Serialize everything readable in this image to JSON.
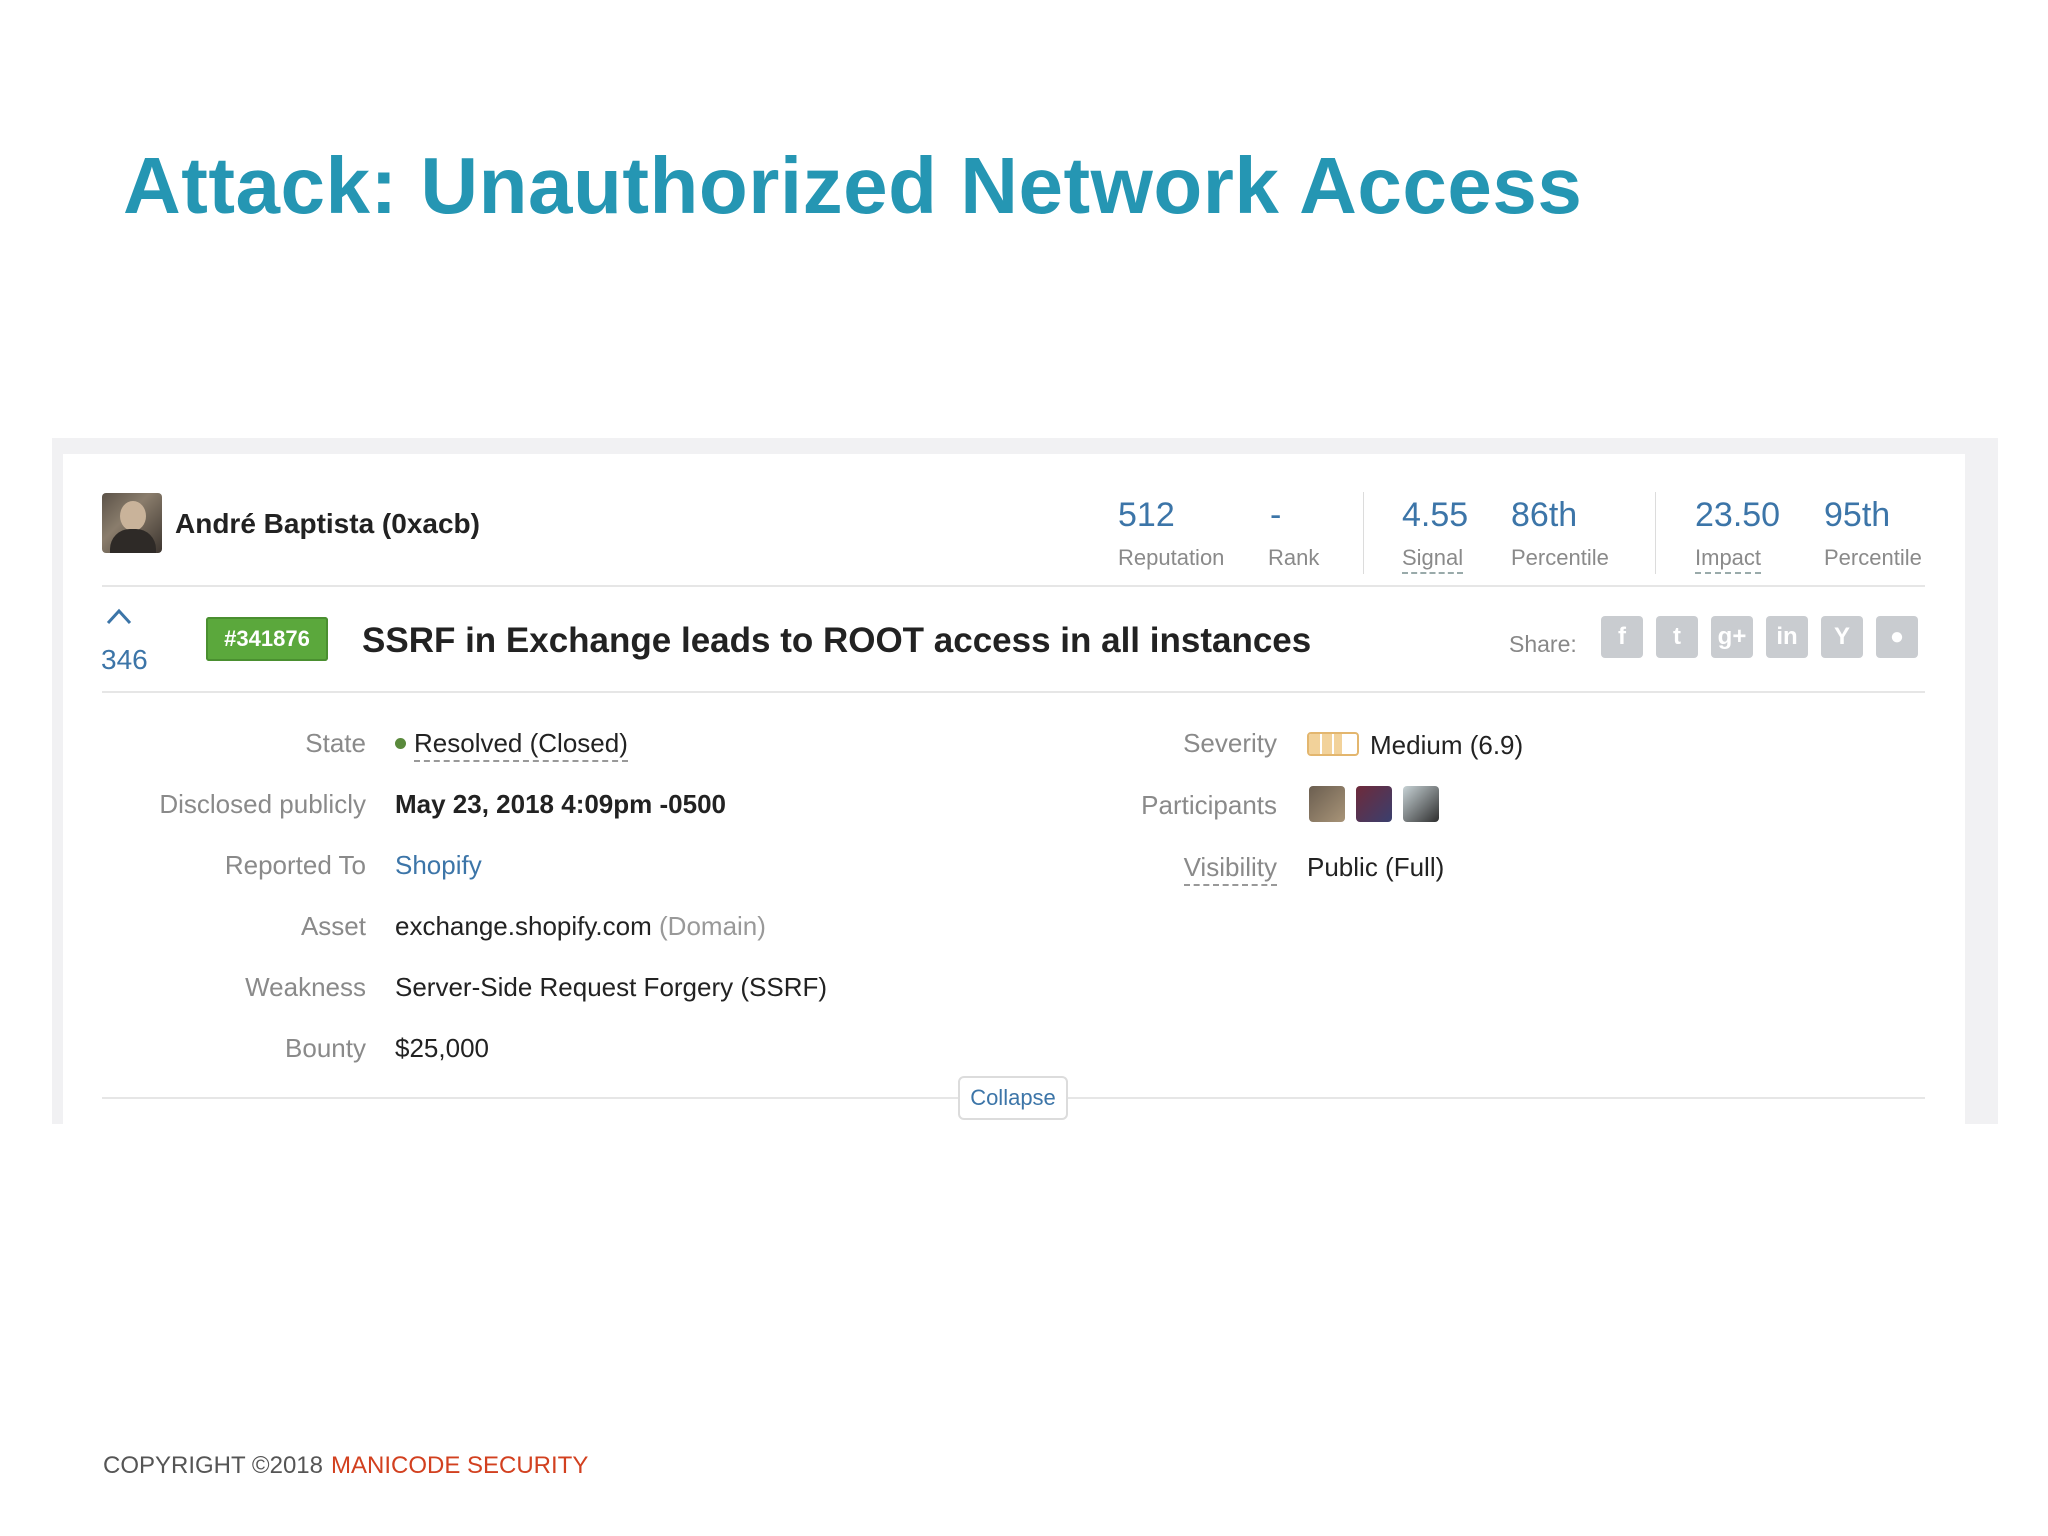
{
  "slide": {
    "title": "Attack: Unauthorized Network Access",
    "copyright": "COPYRIGHT ©2018",
    "brand": "MANICODE SECURITY"
  },
  "profile": {
    "name": "André Baptista (0xacb)",
    "stats": [
      {
        "value": "512",
        "label": "Reputation"
      },
      {
        "value": "-",
        "label": "Rank"
      },
      {
        "value": "4.55",
        "label": "Signal"
      },
      {
        "value": "86th",
        "label": "Percentile"
      },
      {
        "value": "23.50",
        "label": "Impact"
      },
      {
        "value": "95th",
        "label": "Percentile"
      }
    ]
  },
  "report": {
    "votes": "346",
    "id": "#341876",
    "title": "SSRF in Exchange leads to ROOT access in all instances",
    "share_label": "Share:",
    "share_icons": [
      "facebook-icon",
      "twitter-icon",
      "google-plus-icon",
      "linkedin-icon",
      "hacker-news-icon",
      "reddit-icon"
    ],
    "share_glyphs": [
      "f",
      "t",
      "g+",
      "in",
      "Y",
      "●"
    ]
  },
  "details": {
    "state_label": "State",
    "state_value": "Resolved (Closed)",
    "disclosed_label": "Disclosed publicly",
    "disclosed_value": "May 23, 2018 4:09pm -0500",
    "reported_label": "Reported To",
    "reported_value": "Shopify",
    "asset_label": "Asset",
    "asset_value": "exchange.shopify.com",
    "asset_type": "(Domain)",
    "weakness_label": "Weakness",
    "weakness_value": "Server-Side Request Forgery (SSRF)",
    "bounty_label": "Bounty",
    "bounty_value": "$25,000",
    "severity_label": "Severity",
    "severity_value": "Medium (6.9)",
    "severity_level": 0.69,
    "participants_label": "Participants",
    "visibility_label": "Visibility",
    "visibility_value": "Public (Full)"
  },
  "collapse_label": "Collapse",
  "colors": {
    "title": "#2596b3",
    "link": "#3c75a8",
    "report_id_bg": "#5ba83c",
    "brand": "#d2401f",
    "severity": "#e3b66e"
  }
}
